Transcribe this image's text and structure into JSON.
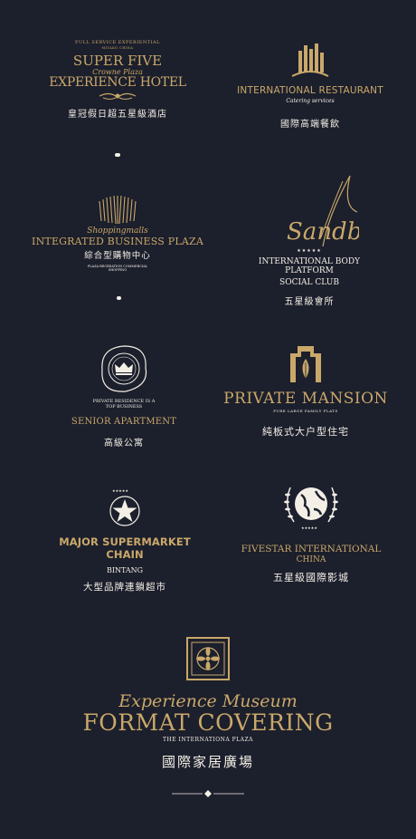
{
  "logos": {
    "l1": {
      "top": "FULL SERVICE EXPERIENTIAL",
      "sub": "MIYAKO CHINA",
      "line1": "SUPER FIVE",
      "script": "Crowne Plaza",
      "line2": "EXPERIENCE HOTEL",
      "cn": "皇冠假日超五星級酒店"
    },
    "l2": {
      "title": "INTERNATIONAL RESTAURANT",
      "sub": "Catering services",
      "cn": "國際高端餐飲"
    },
    "l3": {
      "script": "Shoppingmalls",
      "title": "INTEGRATED BUSINESS PLAZA",
      "cn": "綜合型購物中心",
      "tiny1": "PLAZA RECREATION COMMERCIAL",
      "tiny2": "SHOPPING"
    },
    "l4": {
      "script": "Sandbeach",
      "line1": "INTERNATIONAL BODY  PLATFORM",
      "line2": "SOCIAL CLUB",
      "cn": "五星級會所"
    },
    "l5": {
      "small1": "PRIVATE RESIDENCE IS A",
      "small2": "TOP BUSINESS",
      "title": "SENIOR APARTMENT",
      "cn": "高級公寓"
    },
    "l6": {
      "title": "PRIVATE MANSION",
      "sub": "PURE LARGE FAMILY FLATS",
      "cn": "純板式大户型住宅"
    },
    "l7": {
      "title": "MAJOR SUPERMARKET CHAIN",
      "sub": "BINTANG",
      "cn": "大型品牌連鎖超市"
    },
    "l8": {
      "line1": "FIVESTAR INTERNATIONAL",
      "line2": "CHINA",
      "cn": "五星級國際影城"
    },
    "l9": {
      "script": "Experience Museum",
      "title": "FORMAT COVERING",
      "sub": "THE INTERNATIONA PLAZA",
      "cn": "國際家居廣場"
    }
  }
}
